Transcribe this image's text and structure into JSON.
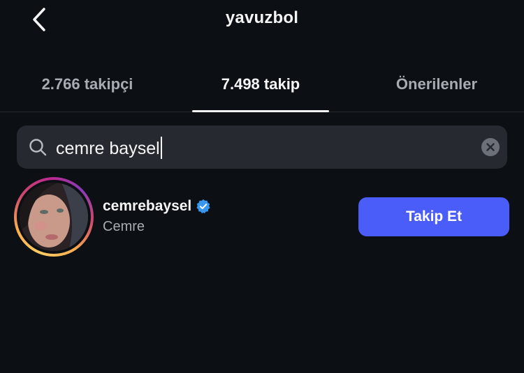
{
  "header": {
    "title": "yavuzbol",
    "back_icon": "chevron-left-icon"
  },
  "tabs": [
    {
      "label": "2.766 takipçi",
      "active": false
    },
    {
      "label": "7.498 takip",
      "active": true
    },
    {
      "label": "Önerilenler",
      "active": false
    }
  ],
  "search": {
    "value": "cemre baysel",
    "icon": "search-icon",
    "clear_icon": "clear-icon"
  },
  "result": {
    "username": "cemrebaysel",
    "fullname": "Cemre",
    "verified": true,
    "follow_label": "Takip Et"
  },
  "colors": {
    "background": "#0c1014",
    "search_bg": "#262a30",
    "follow_button": "#4a5df9",
    "verified_badge": "#3897f0",
    "muted_text": "#a8acb2"
  }
}
